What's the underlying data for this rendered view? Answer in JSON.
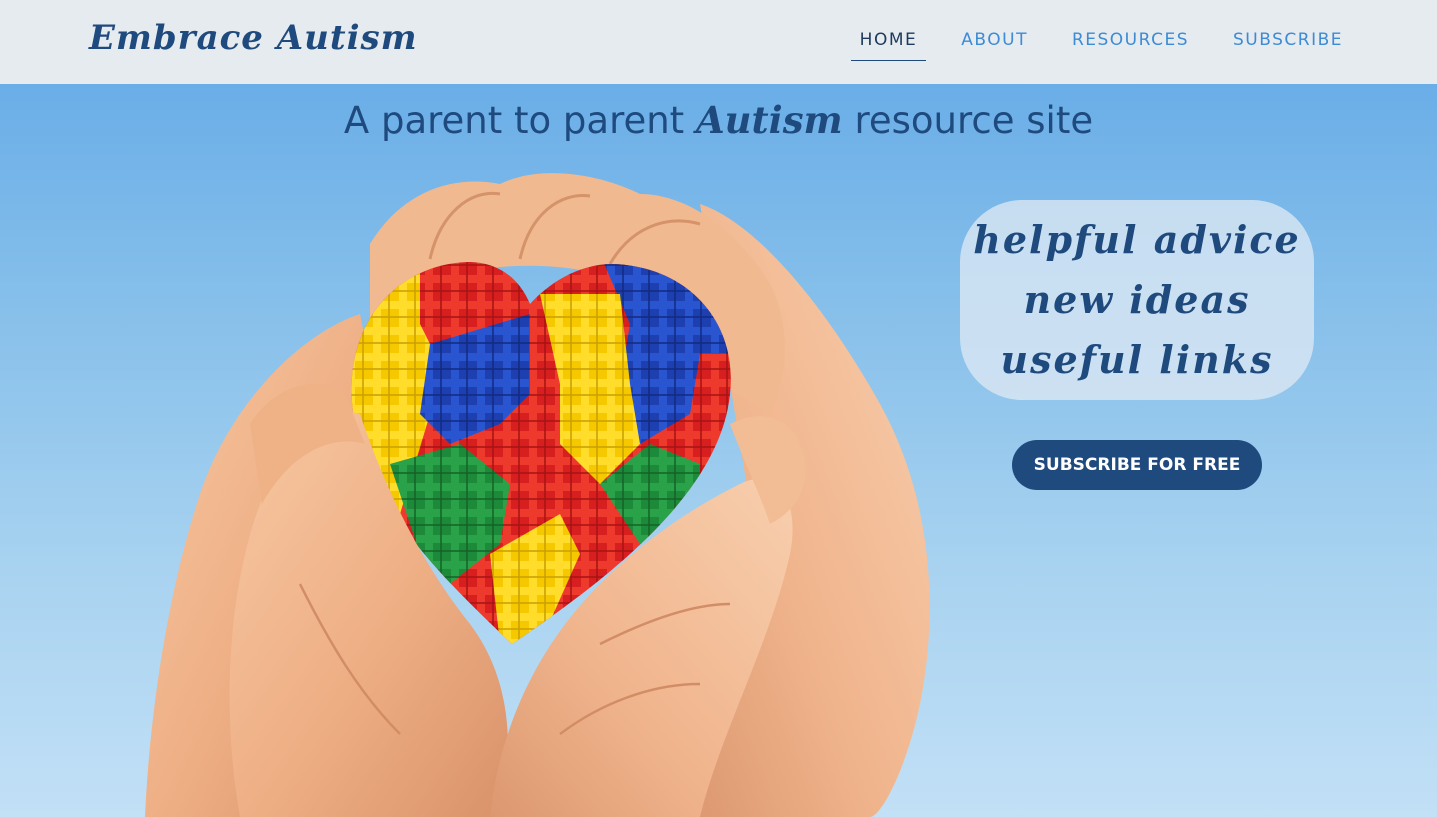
{
  "header": {
    "brand": "Embrace Autism",
    "nav": [
      {
        "label": "HOME",
        "active": true
      },
      {
        "label": "ABOUT",
        "active": false
      },
      {
        "label": "RESOURCES",
        "active": false
      },
      {
        "label": "SUBSCRIBE",
        "active": false
      }
    ]
  },
  "hero": {
    "tagline_before": "A parent to parent ",
    "tagline_emphasis": "Autism",
    "tagline_after": " resource site",
    "bubble_lines": [
      "helpful advice",
      "new ideas",
      "useful links"
    ],
    "cta_label": "SUBSCRIBE FOR FREE",
    "image_subject": "hands-holding-puzzle-heart-icon"
  },
  "colors": {
    "header_bg": "#e6ebf0",
    "brand": "#1f4a7e",
    "nav_link": "#3c8bd4",
    "nav_active": "#1e3a5c",
    "sky_top": "#6aaee8",
    "sky_bottom": "#c2e0f6",
    "button_bg": "#1f4a7e",
    "button_text": "#ffffff",
    "skin": "#f0b48a",
    "puzzle_red": "#d81f1f",
    "puzzle_blue": "#1d3fb0",
    "puzzle_yellow": "#f5c800",
    "puzzle_green": "#1d8a3a"
  }
}
